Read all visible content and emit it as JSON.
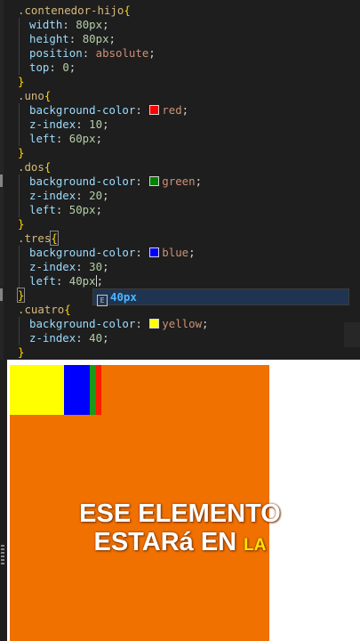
{
  "editor": {
    "lines": [
      {
        "selector": ".contenedor-hijo",
        "open": "{"
      },
      {
        "prop": "width",
        "value": "80px",
        "kind": "num"
      },
      {
        "prop": "height",
        "value": "80px",
        "kind": "num"
      },
      {
        "prop": "position",
        "value": "absolute",
        "kind": "str"
      },
      {
        "prop": "top",
        "value": "0",
        "kind": "num"
      },
      {
        "close": "}"
      },
      {
        "selector": ".uno",
        "open": "{"
      },
      {
        "prop": "background-color",
        "value": "red",
        "kind": "str",
        "swatch": "#ff0000"
      },
      {
        "prop": "z-index",
        "value": "10",
        "kind": "num"
      },
      {
        "prop": "left",
        "value": "60px",
        "kind": "num"
      },
      {
        "close": "}"
      },
      {
        "selector": ".dos",
        "open": "{"
      },
      {
        "prop": "background-color",
        "value": "green",
        "kind": "str",
        "swatch": "#008000"
      },
      {
        "prop": "z-index",
        "value": "20",
        "kind": "num"
      },
      {
        "prop": "left",
        "value": "50px",
        "kind": "num"
      },
      {
        "close": "}"
      },
      {
        "selector": ".tres",
        "open": "{"
      },
      {
        "prop": "background-color",
        "value": "blue",
        "kind": "str",
        "swatch": "#0000ff"
      },
      {
        "prop": "z-index",
        "value": "30",
        "kind": "num"
      },
      {
        "prop": "left",
        "value": "40px",
        "kind": "num"
      },
      {
        "close": "}"
      },
      {
        "selector": ".cuatro",
        "open": "{"
      },
      {
        "prop": "background-color",
        "value": "yellow",
        "kind": "str",
        "swatch": "#ffff00"
      },
      {
        "prop": "z-index",
        "value": "40",
        "kind": "num"
      },
      {
        "close": "}"
      }
    ],
    "suggestion": {
      "icon": "E",
      "text": "40px"
    },
    "colors": {
      "selector": "#d7ba7d",
      "brace": "#ffd700",
      "property": "#9cdcfe",
      "number": "#b5cea8",
      "string": "#ce9178"
    }
  },
  "preview": {
    "boxes": [
      {
        "name": "yellow",
        "color": "#ffff00"
      },
      {
        "name": "blue",
        "color": "#0000ff"
      },
      {
        "name": "green",
        "color": "#1a9a1a"
      },
      {
        "name": "red",
        "color": "#ff1a00"
      }
    ],
    "parent_color": "#f07000",
    "caption": {
      "line1": "ESE ELEMENTO",
      "line2": "ESTARá EN",
      "highlight": "LA"
    }
  }
}
